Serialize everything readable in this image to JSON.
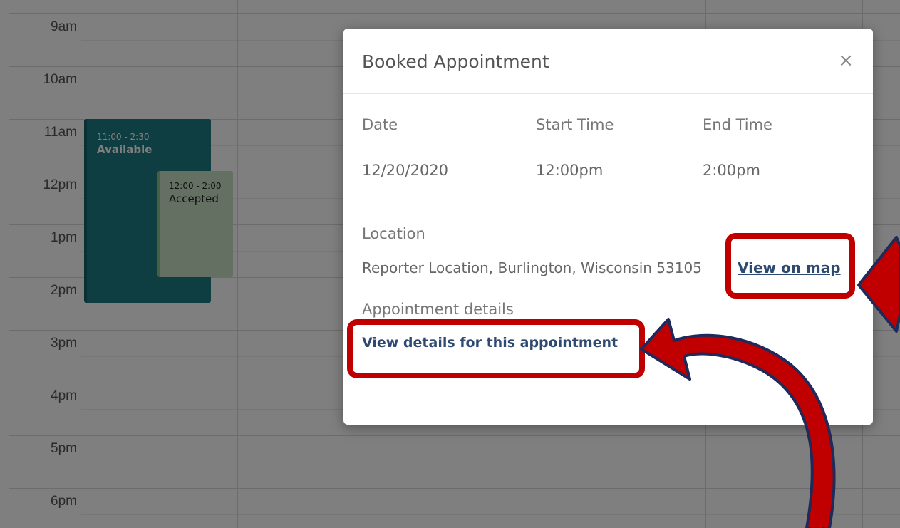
{
  "calendar": {
    "times": [
      "9am",
      "10am",
      "11am",
      "12pm",
      "1pm",
      "2pm",
      "3pm",
      "4pm",
      "5pm",
      "6pm"
    ],
    "events": [
      {
        "time": "11:00 - 2:30",
        "status": "Available"
      },
      {
        "time": "12:00 - 2:00",
        "status": "Accepted"
      }
    ]
  },
  "modal": {
    "title": "Booked Appointment",
    "close_glyph": "×",
    "columns": {
      "date_label": "Date",
      "start_label": "Start Time",
      "end_label": "End Time",
      "date_value": "12/20/2020",
      "start_value": "12:00pm",
      "end_value": "2:00pm"
    },
    "location_label": "Location",
    "location_value": "Reporter Location, Burlington, Wisconsin 53105",
    "view_map_link": "View on map",
    "details_label": "Appointment details",
    "details_link": "View details for this appointment"
  },
  "annotation": {
    "highlight_color": "#c00000",
    "arrow_outline_color": "#1f2a5a"
  }
}
